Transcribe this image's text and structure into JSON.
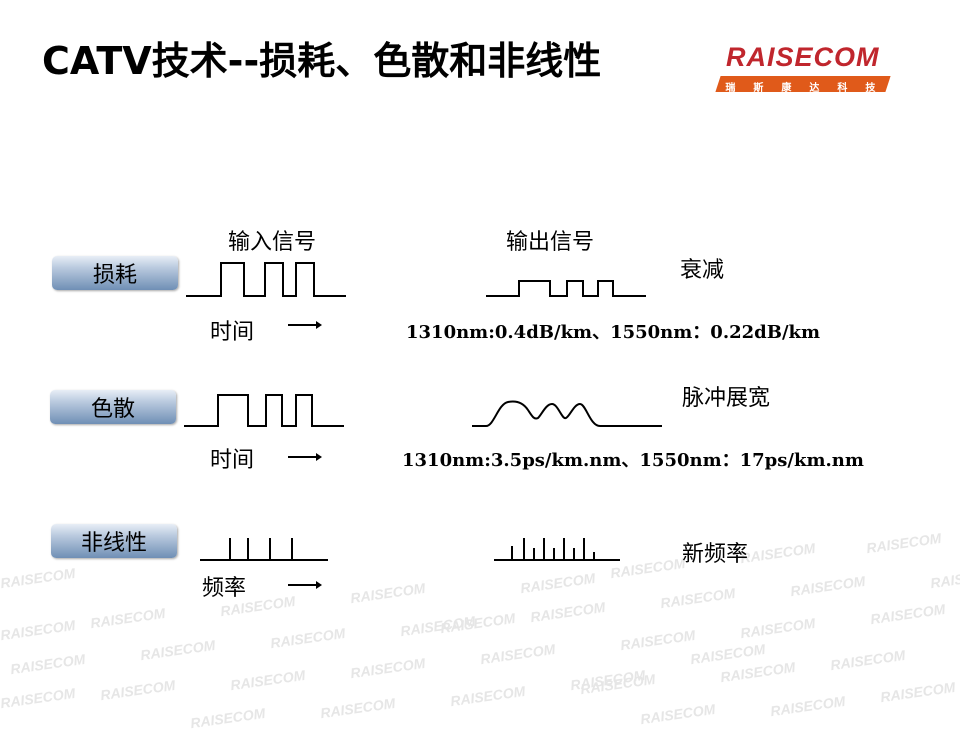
{
  "title": "CATV技术--损耗、色散和非线性",
  "logo": {
    "word": "RAISECOM",
    "sub": [
      "瑞",
      "斯",
      "康",
      "达",
      "科",
      "技"
    ]
  },
  "headers": {
    "input": "输入信号",
    "output": "输出信号"
  },
  "rows": [
    {
      "label": "损耗",
      "effect": "衰减",
      "axis": "时间",
      "spec": "1310nm:0.4dB/km、1550nm：0.22dB/km"
    },
    {
      "label": "色散",
      "effect": "脉冲展宽",
      "axis": "时间",
      "spec": "1310nm:3.5ps/km.nm、1550nm：17ps/km.nm"
    },
    {
      "label": "非线性",
      "effect": "新频率",
      "axis": "频率"
    }
  ],
  "colors": {
    "label_button": "#6f8fb5",
    "logo_red": "#c0262d",
    "logo_orange": "#e05a1a"
  },
  "icons": {
    "axis_arrow": "right-arrow-icon"
  },
  "watermark": "RAISECOM"
}
